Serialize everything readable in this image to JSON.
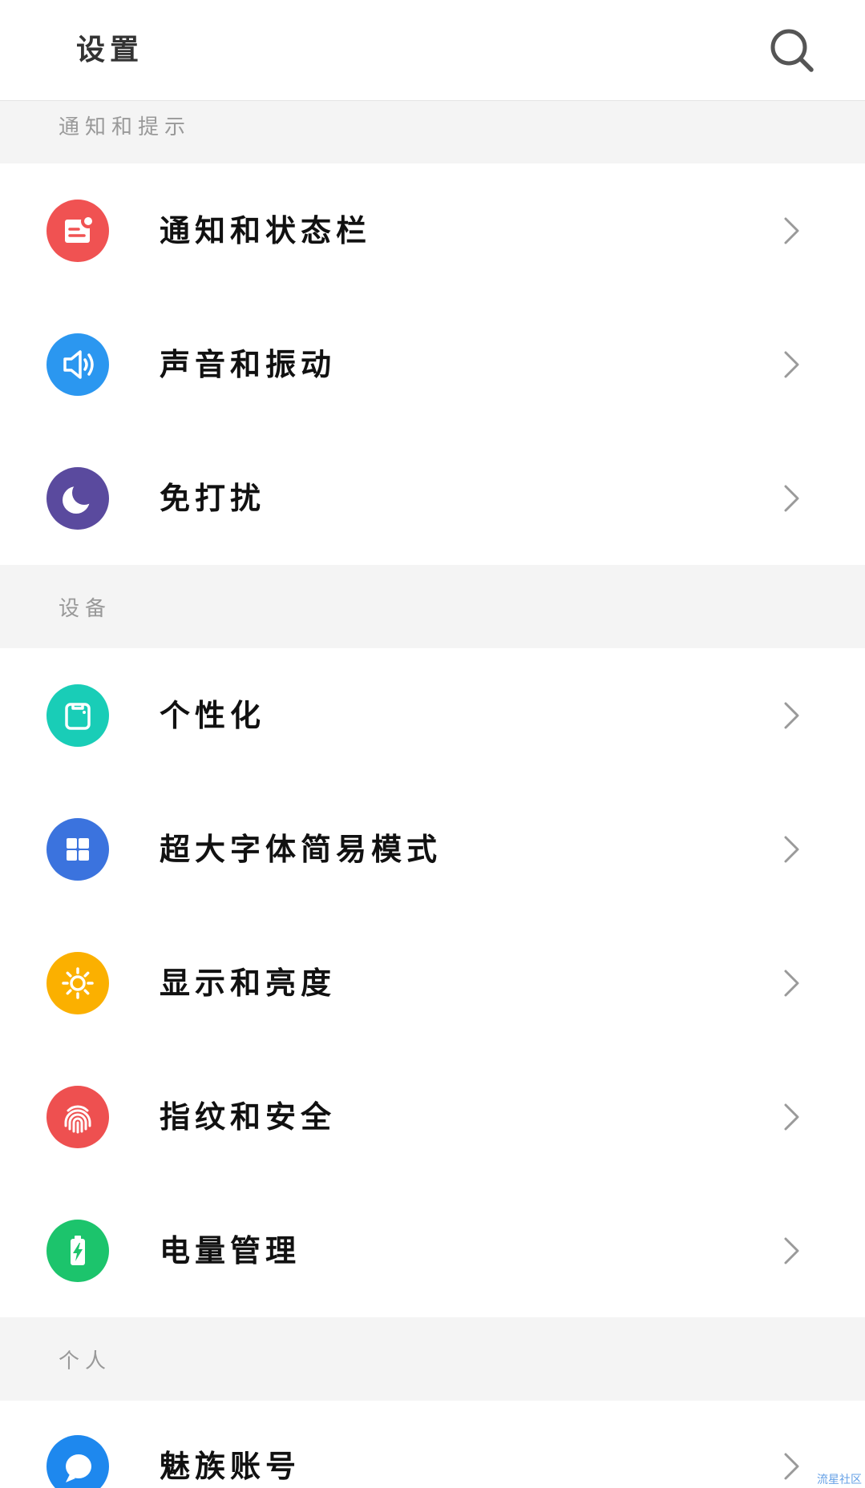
{
  "header": {
    "title": "设置",
    "search_icon": "search-icon"
  },
  "sections": [
    {
      "title": "通知和提示",
      "items": [
        {
          "label": "通知和状态栏",
          "icon": "notification-icon",
          "color": "#f05252"
        },
        {
          "label": "声音和振动",
          "icon": "speaker-icon",
          "color": "#2b97f0"
        },
        {
          "label": "免打扰",
          "icon": "moon-icon",
          "color": "#5a4a9e"
        }
      ]
    },
    {
      "title": "设备",
      "items": [
        {
          "label": "个性化",
          "icon": "personalization-icon",
          "color": "#19cdb7"
        },
        {
          "label": "超大字体简易模式",
          "icon": "grid-icon",
          "color": "#3b73de"
        },
        {
          "label": "显示和亮度",
          "icon": "sun-icon",
          "color": "#fbb000"
        },
        {
          "label": "指纹和安全",
          "icon": "fingerprint-icon",
          "color": "#ee5050"
        },
        {
          "label": "电量管理",
          "icon": "battery-icon",
          "color": "#1cc46c"
        }
      ]
    },
    {
      "title": "个人",
      "items": [
        {
          "label": "魅族账号",
          "icon": "chat-bubble-icon",
          "color": "#1e88ee"
        }
      ]
    }
  ],
  "chevron_icon": "chevron-right-icon",
  "watermark": "流星社区"
}
